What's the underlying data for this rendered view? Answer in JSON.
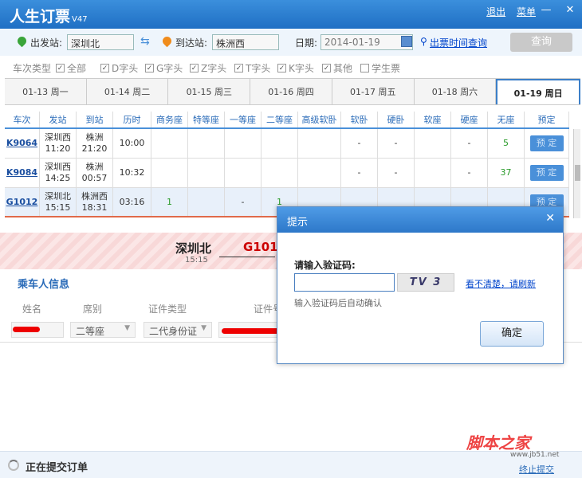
{
  "app": {
    "title": "人生订票",
    "version": "V47",
    "logout": "退出",
    "menu": "菜单",
    "minimize": "—",
    "close": "✕"
  },
  "search": {
    "from_label": "出发站:",
    "from_value": "深圳北",
    "to_label": "到达站:",
    "to_value": "株洲西",
    "date_label": "日期:",
    "date_value": "2014-01-19",
    "time_link": "出票时间查询",
    "query": "查询"
  },
  "filters": {
    "label": "车次类型",
    "items": [
      {
        "label": "全部",
        "checked": true
      },
      {
        "label": "D字头",
        "checked": true
      },
      {
        "label": "G字头",
        "checked": true
      },
      {
        "label": "Z字头",
        "checked": true
      },
      {
        "label": "T字头",
        "checked": true
      },
      {
        "label": "K字头",
        "checked": true
      },
      {
        "label": "其他",
        "checked": true
      },
      {
        "label": "学生票",
        "checked": false
      }
    ]
  },
  "date_tabs": [
    {
      "label": "01-13 周一"
    },
    {
      "label": "01-14 周二"
    },
    {
      "label": "01-15 周三"
    },
    {
      "label": "01-16 周四"
    },
    {
      "label": "01-17 周五"
    },
    {
      "label": "01-18 周六"
    },
    {
      "label": "01-19 周日",
      "active": true
    }
  ],
  "table": {
    "headers": [
      "车次",
      "发站",
      "到站",
      "历时",
      "商务座",
      "特等座",
      "一等座",
      "二等座",
      "高级软卧",
      "软卧",
      "硬卧",
      "软座",
      "硬座",
      "无座",
      "预定"
    ],
    "rows": [
      {
        "no": "K9064",
        "from": "深圳西",
        "dep": "11:20",
        "to": "株洲",
        "arr": "21:20",
        "dur": "10:00",
        "c": [
          "",
          "",
          "",
          "",
          "",
          "-",
          "-",
          "",
          "-",
          "5"
        ],
        "book": "预 定"
      },
      {
        "no": "K9084",
        "from": "深圳西",
        "dep": "14:25",
        "to": "株洲",
        "arr": "00:57",
        "dur": "10:32",
        "c": [
          "",
          "",
          "",
          "",
          "",
          "-",
          "-",
          "",
          "-",
          "37"
        ],
        "book": "预 定"
      },
      {
        "no": "G1012",
        "from": "深圳北",
        "dep": "15:15",
        "to": "株洲西",
        "arr": "18:31",
        "dur": "03:16",
        "c": [
          "1",
          "",
          "-",
          "1",
          "",
          "",
          "",
          "",
          "",
          ""
        ],
        "book": "预 定"
      }
    ]
  },
  "info_band": {
    "from": "深圳北",
    "time": "15:15",
    "train": "G1012"
  },
  "passenger": {
    "section_title": "乘车人信息",
    "headers": [
      "姓名",
      "席别",
      "证件类型",
      "证件号"
    ],
    "seat": "二等座",
    "id_type": "二代身份证"
  },
  "bottom": {
    "status": "正在提交订单",
    "cancel": "终止提交"
  },
  "watermark": {
    "text": "脚本之家",
    "url": "www.jb51.net"
  },
  "dialog": {
    "title": "提示",
    "label": "请输入验证码:",
    "captcha": "TV 3",
    "refresh": "看不清楚，请刷新",
    "hint": "输入验证码后自动确认",
    "ok": "确定"
  }
}
